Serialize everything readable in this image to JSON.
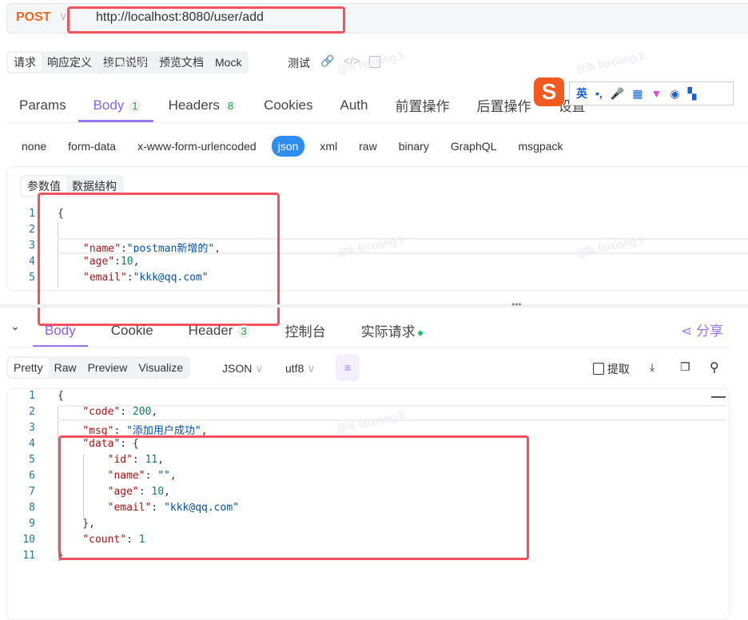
{
  "request": {
    "method": "POST",
    "url": "http://localhost:8080/user/add"
  },
  "top_tabs": [
    {
      "label": "请求",
      "active": true
    },
    {
      "label": "响应定义"
    },
    {
      "label": "接口说明"
    },
    {
      "label": "预览文档"
    },
    {
      "label": "Mock"
    }
  ],
  "test_label": "测试",
  "req_tabs": [
    {
      "label": "Params"
    },
    {
      "label": "Body",
      "badge": "1",
      "active": true
    },
    {
      "label": "Headers",
      "badge": "8"
    },
    {
      "label": "Cookies"
    },
    {
      "label": "Auth"
    },
    {
      "label": "前置操作"
    },
    {
      "label": "后置操作"
    },
    {
      "label": "设置"
    }
  ],
  "body_types": [
    "none",
    "form-data",
    "x-www-form-urlencoded",
    "json",
    "xml",
    "raw",
    "binary",
    "GraphQL",
    "msgpack"
  ],
  "body_type_active": "json",
  "body_sub_tabs": [
    "参数值",
    "数据结构"
  ],
  "request_body": [
    [
      [
        "p",
        "{"
      ]
    ],
    [],
    [
      [
        "k",
        "\"name\""
      ],
      [
        "p",
        ":"
      ],
      [
        "s",
        "\"postman新增的\""
      ],
      [
        "p",
        ","
      ]
    ],
    [
      [
        "k",
        "\"age\""
      ],
      [
        "p",
        ":"
      ],
      [
        "n",
        "10"
      ],
      [
        "p",
        ","
      ]
    ],
    [
      [
        "k",
        "\"email\""
      ],
      [
        "p",
        ":"
      ],
      [
        "s",
        "\"kkk@qq.com\""
      ]
    ]
  ],
  "resp_tabs": [
    {
      "label": "Body",
      "active": true
    },
    {
      "label": "Cookie"
    },
    {
      "label": "Header",
      "badge": "3"
    },
    {
      "label": "控制台"
    },
    {
      "label": "实际请求"
    }
  ],
  "share_label": "分享",
  "view_modes": [
    "Pretty",
    "Raw",
    "Preview",
    "Visualize"
  ],
  "format": "JSON",
  "encoding": "utf8",
  "extract_label": "提取",
  "response_body": [
    [
      [
        "p",
        "{"
      ]
    ],
    [
      [
        "k",
        "    \"code\""
      ],
      [
        "p",
        ": "
      ],
      [
        "n",
        "200"
      ],
      [
        "p",
        ","
      ]
    ],
    [
      [
        "k",
        "    \"msg\""
      ],
      [
        "p",
        ": "
      ],
      [
        "s",
        "\"添加用户成功\""
      ],
      [
        "p",
        ","
      ]
    ],
    [
      [
        "k",
        "    \"data\""
      ],
      [
        "p",
        ": {"
      ]
    ],
    [
      [
        "k",
        "        \"id\""
      ],
      [
        "p",
        ": "
      ],
      [
        "n",
        "11"
      ],
      [
        "p",
        ","
      ]
    ],
    [
      [
        "k",
        "        \"name\""
      ],
      [
        "p",
        ": "
      ],
      [
        "s",
        "\"\""
      ],
      [
        "p",
        ","
      ]
    ],
    [
      [
        "k",
        "        \"age\""
      ],
      [
        "p",
        ": "
      ],
      [
        "n",
        "10"
      ],
      [
        "p",
        ","
      ]
    ],
    [
      [
        "k",
        "        \"email\""
      ],
      [
        "p",
        ": "
      ],
      [
        "s",
        "\"kkk@qq.com\""
      ]
    ],
    [
      [
        "p",
        "    },"
      ]
    ],
    [
      [
        "k",
        "    \"count\""
      ],
      [
        "p",
        ": "
      ],
      [
        "n",
        "1"
      ]
    ],
    [
      [
        "p",
        "}"
      ]
    ]
  ],
  "ime": {
    "lang": "英"
  },
  "watermark": "@lk feixiang.li",
  "colors": {
    "accent": "#8a63e8",
    "method": "#f0651d",
    "json_active": "#2e8ef0",
    "highlight_box": "#f2525e"
  }
}
